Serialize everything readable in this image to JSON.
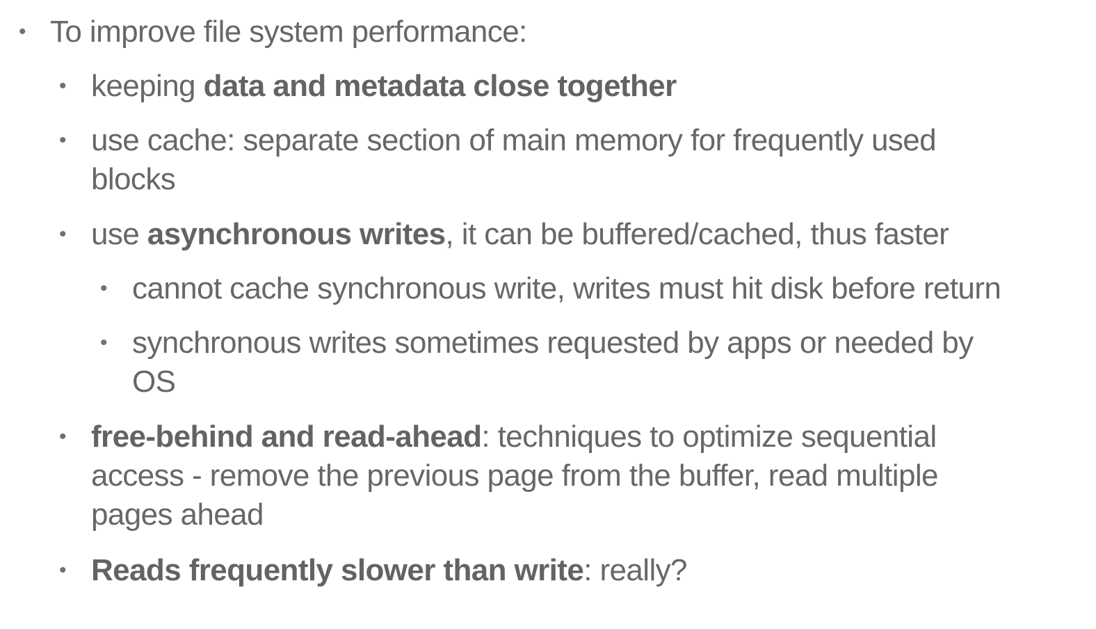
{
  "slide": {
    "items": [
      {
        "intro": "To improve file system performance:"
      },
      {
        "lead": "keeping ",
        "bold": "data and metadata close together"
      },
      {
        "line1": "use cache: separate section of main memory for frequently used",
        "line2": "blocks"
      },
      {
        "lead": "use ",
        "bold": "asynchronous writes",
        "rest": ", it can be buffered/cached, thus faster"
      },
      {
        "text": "cannot cache synchronous write, writes must hit disk before return"
      },
      {
        "line1": "synchronous writes sometimes requested by apps or needed by",
        "line2": "OS"
      },
      {
        "bold": "free-behind and read-ahead",
        "rest": ": techniques to optimize sequential",
        "line2": "access - remove the previous page from the buffer, read multiple",
        "line3": "pages ahead"
      },
      {
        "bold": "Reads frequently slower than write",
        "rest": ": really?"
      }
    ]
  }
}
